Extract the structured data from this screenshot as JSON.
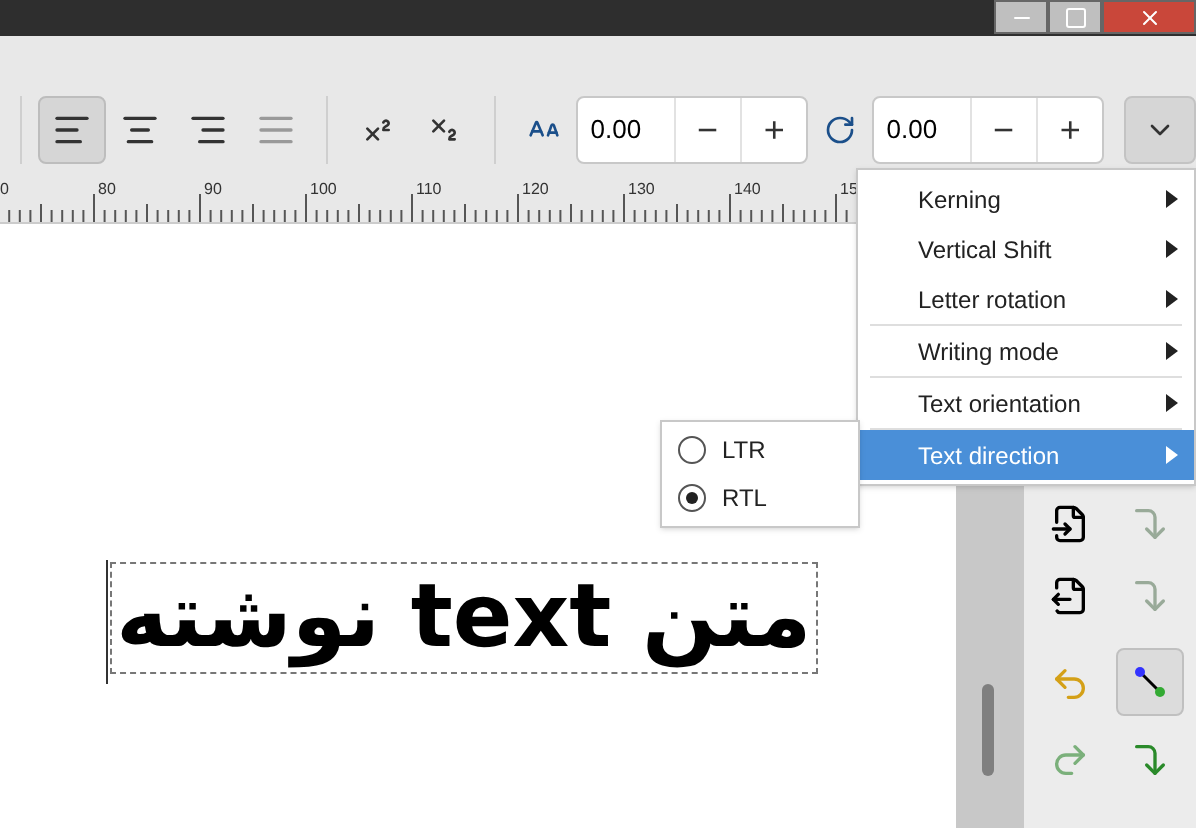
{
  "toolbar": {
    "alignment_buttons": [
      {
        "kind": "left",
        "selected": true
      },
      {
        "kind": "center",
        "selected": false
      },
      {
        "kind": "right",
        "selected": false
      },
      {
        "kind": "justify",
        "selected": false
      }
    ],
    "spin_fields": [
      {
        "kind": "size",
        "value": "0.00",
        "minus": "−",
        "plus": "+"
      },
      {
        "kind": "rotate",
        "value": "0.00",
        "minus": "−",
        "plus": "+"
      }
    ]
  },
  "ruler": {
    "labels": [
      "0",
      "80",
      "90",
      "100",
      "110",
      "120",
      "130",
      "140",
      "15"
    ]
  },
  "canvas": {
    "text": "متن text نوشته"
  },
  "menu": {
    "items": [
      {
        "kind": "item",
        "label": "Kerning",
        "selected": false
      },
      {
        "kind": "item",
        "label": "Vertical Shift",
        "selected": false
      },
      {
        "kind": "item",
        "label": "Letter rotation",
        "selected": false
      },
      {
        "kind": "separator"
      },
      {
        "kind": "item",
        "label": "Writing mode",
        "selected": false
      },
      {
        "kind": "separator"
      },
      {
        "kind": "item",
        "label": "Text orientation",
        "selected": false
      },
      {
        "kind": "separator"
      },
      {
        "kind": "item",
        "label": "Text direction",
        "selected": true
      }
    ]
  },
  "submenu": {
    "options": [
      {
        "label": "LTR",
        "selected": false
      },
      {
        "label": "RTL",
        "selected": true
      }
    ]
  }
}
